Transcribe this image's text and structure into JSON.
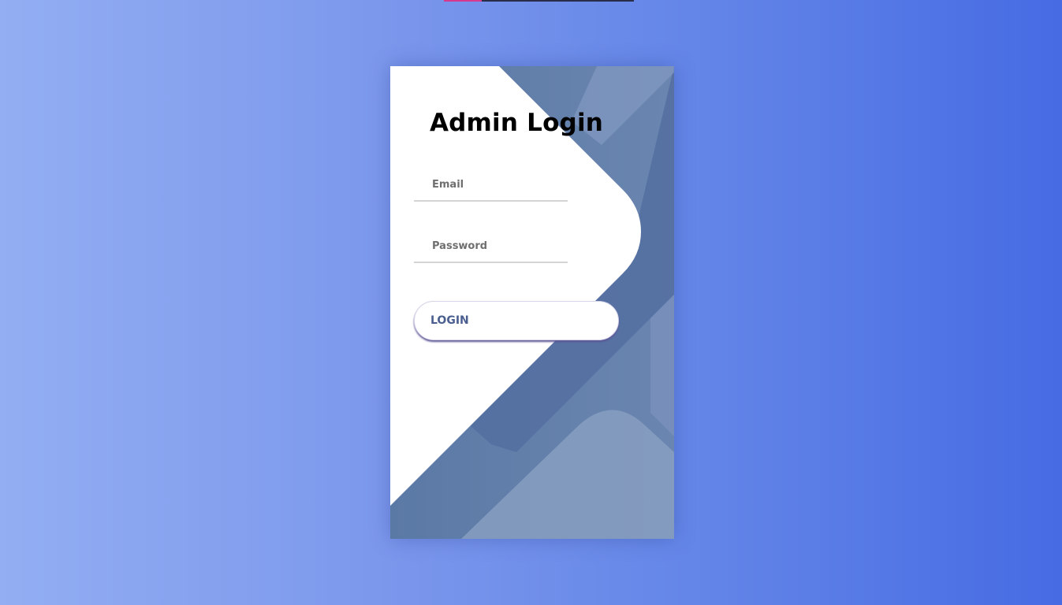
{
  "page": {
    "colors": {
      "background_left": "#93aef2",
      "background_right": "#466be3",
      "card_background": "#ffffff",
      "card_shape_primary": "#5d7aa6",
      "card_shape_light": "#7e97b9",
      "button_text": "#4a5f8f",
      "top_bar_pink": "#d63a8e",
      "top_bar_dark": "#2a2d4a"
    }
  },
  "login_form": {
    "title": "Admin Login",
    "email": {
      "placeholder": "Email",
      "value": ""
    },
    "password": {
      "placeholder": "Password",
      "value": ""
    },
    "submit_label": "LOGIN"
  }
}
